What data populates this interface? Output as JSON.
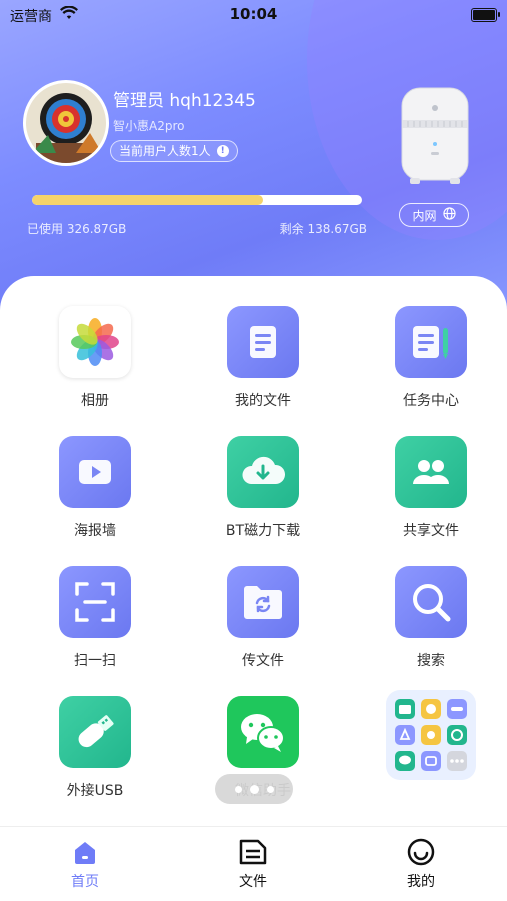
{
  "status_bar": {
    "carrier": "运营商",
    "time": "10:04"
  },
  "user": {
    "name": "管理员 hqh12345",
    "device": "智小惠A2pro",
    "users_label": "当前用户人数1人"
  },
  "storage": {
    "used_label": "已使用 326.87GB",
    "remaining_label": "剩余 138.67GB",
    "used_fraction": 0.7
  },
  "network_button": "内网",
  "grid": [
    {
      "label": "相册",
      "icon": "photos-icon"
    },
    {
      "label": "我的文件",
      "icon": "file-icon"
    },
    {
      "label": "任务中心",
      "icon": "task-icon"
    },
    {
      "label": "海报墙",
      "icon": "video-icon"
    },
    {
      "label": "BT磁力下载",
      "icon": "cloud-download-icon"
    },
    {
      "label": "共享文件",
      "icon": "share-users-icon"
    },
    {
      "label": "扫一扫",
      "icon": "scan-icon"
    },
    {
      "label": "传文件",
      "icon": "transfer-folder-icon"
    },
    {
      "label": "搜索",
      "icon": "search-icon"
    },
    {
      "label": "外接USB",
      "icon": "usb-icon"
    },
    {
      "label": "微信助手",
      "icon": "wechat-icon"
    },
    {
      "label": "",
      "icon": "more-apps-icon"
    }
  ],
  "colors": {
    "accent": "#6f7cf7",
    "progress": "#f5d36b",
    "green": "#22b68d"
  },
  "tabs": [
    {
      "label": "首页",
      "icon": "home-icon",
      "active": true
    },
    {
      "label": "文件",
      "icon": "document-icon",
      "active": false
    },
    {
      "label": "我的",
      "icon": "profile-icon",
      "active": false
    }
  ]
}
